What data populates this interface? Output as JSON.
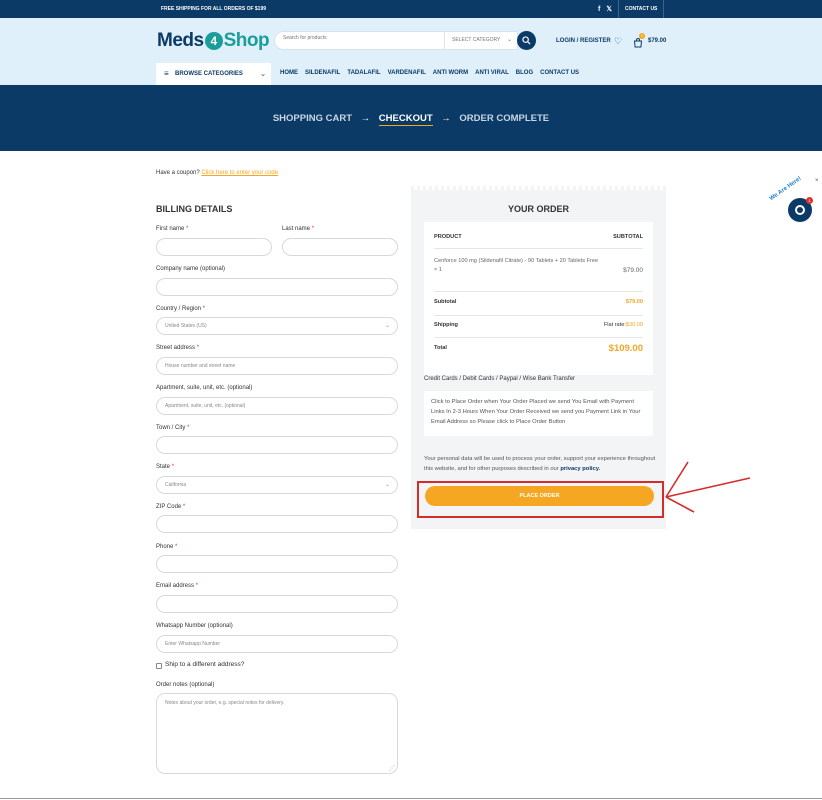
{
  "topbar": {
    "shipping_text": "FREE SHIPPING FOR ALL ORDERS OF $199",
    "contact": "CONTACT US",
    "social_icons": [
      "facebook-icon",
      "x-icon"
    ]
  },
  "header": {
    "logo_left": "Meds",
    "logo_mid": "4",
    "logo_right": "Shop",
    "search_placeholder": "Search for products",
    "category": "SELECT CATEGORY",
    "login": "LOGIN / REGISTER",
    "cart_count": "1",
    "cart_total": "$79.00"
  },
  "nav": {
    "browse": "BROWSE CATEGORIES",
    "items": [
      "HOME",
      "SILDENAFIL",
      "TADALAFIL",
      "VARDENAFIL",
      "ANTI WORM",
      "ANTI VIRAL",
      "BLOG",
      "CONTACT US"
    ]
  },
  "steps": {
    "cart": "SHOPPING CART",
    "checkout": "CHECKOUT",
    "complete": "ORDER COMPLETE",
    "arrow": "→"
  },
  "coupon": {
    "text": "Have a coupon?",
    "link": "Click here to enter your code"
  },
  "billing": {
    "title": "BILLING DETAILS",
    "first_name": "First name",
    "last_name": "Last name",
    "company": "Company name (optional)",
    "country": "Country / Region",
    "country_value": "United States (US)",
    "street": "Street address",
    "street_placeholder": "House number and street name",
    "apartment": "Apartment, suite, unit, etc. (optional)",
    "apartment_placeholder": "Apartment, suite, unit, etc. (optional)",
    "town": "Town / City",
    "state": "State",
    "state_value": "California",
    "zip": "ZIP Code",
    "phone": "Phone",
    "email": "Email address",
    "whatsapp": "Whatsapp Number (optional)",
    "whatsapp_placeholder": "Enter Whatsapp Number",
    "ship_different": "Ship to a different address?",
    "notes": "Order notes (optional)",
    "notes_placeholder": "Notes about your order, e.g. special notes for delivery.",
    "required_mark": "*"
  },
  "order": {
    "title": "YOUR ORDER",
    "col_product": "PRODUCT",
    "col_subtotal": "SUBTOTAL",
    "item_name": "Cenforce 100 mg (Sildenafil Citrate) - 90 Tablets + 20 Tablets Free",
    "item_qty": "× 1",
    "item_price": "$79.00",
    "subtotal_label": "Subtotal",
    "subtotal_value": "$79.00",
    "shipping_label": "Shipping",
    "shipping_prefix": "Flat rate:",
    "shipping_value": "$30.00",
    "total_label": "Total",
    "total_value": "$109.00",
    "payment_method": "Credit Cards / Debit Cards / Paypal / Wise Bank Transfer",
    "payment_desc": "Click to Place Order when Your Order Placed we send You Email with Payment Links In 2-3 Hours When Your Order Received we send you Payment Link in Your Email Address so Please click to Place Order Button",
    "privacy_text": "Your personal data will be used to process your order, support your experience throughout this website, and for other purposes described in our",
    "privacy_link": "privacy policy.",
    "place_order": "PLACE ORDER"
  },
  "chat": {
    "badge": "We Are Here!",
    "count": "1",
    "close": "×"
  },
  "colors": {
    "navy": "#0b3a66",
    "accent": "#f5a623",
    "teal": "#1b9e9b",
    "annotation_red": "#d62b2b"
  }
}
